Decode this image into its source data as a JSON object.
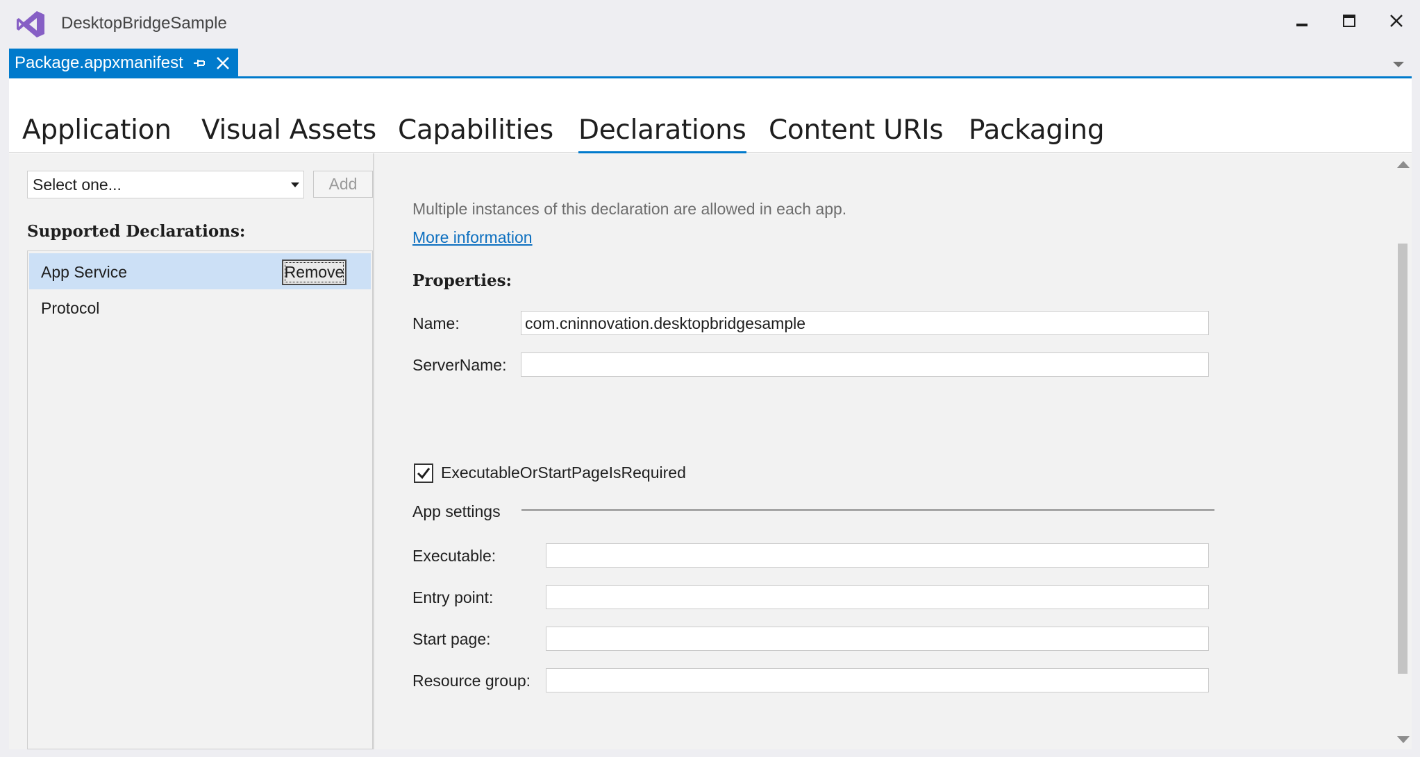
{
  "window": {
    "title": "DesktopBridgeSample",
    "logo_icon": "visual-studio-logo",
    "accent_color": "#007acc"
  },
  "doc_tab": {
    "label": "Package.appxmanifest",
    "pin_icon": "pin-icon",
    "close_icon": "close-icon"
  },
  "designer_tabs": [
    {
      "label": "Application",
      "active": false
    },
    {
      "label": "Visual Assets",
      "active": false
    },
    {
      "label": "Capabilities",
      "active": false
    },
    {
      "label": "Declarations",
      "active": true
    },
    {
      "label": "Content URIs",
      "active": false
    },
    {
      "label": "Packaging",
      "active": false
    }
  ],
  "left_panel": {
    "select_value": "Select one...",
    "add_label": "Add",
    "heading": "Supported Declarations:",
    "items": [
      {
        "label": "App Service",
        "selected": true
      },
      {
        "label": "Protocol",
        "selected": false
      }
    ],
    "remove_label": "Remove"
  },
  "right_panel": {
    "description": "Multiple instances of this declaration are allowed in each app.",
    "more_info": "More information",
    "properties_heading": "Properties:",
    "name_label": "Name:",
    "name_value": "com.cninnovation.desktopbridgesample",
    "servername_label": "ServerName:",
    "servername_value": "",
    "checkbox_label": "ExecutableOrStartPageIsRequired",
    "checkbox_checked": true,
    "app_settings_label": "App settings",
    "executable_label": "Executable:",
    "executable_value": "",
    "entry_point_label": "Entry point:",
    "entry_point_value": "",
    "start_page_label": "Start page:",
    "start_page_value": "",
    "resource_group_label": "Resource group:",
    "resource_group_value": ""
  }
}
